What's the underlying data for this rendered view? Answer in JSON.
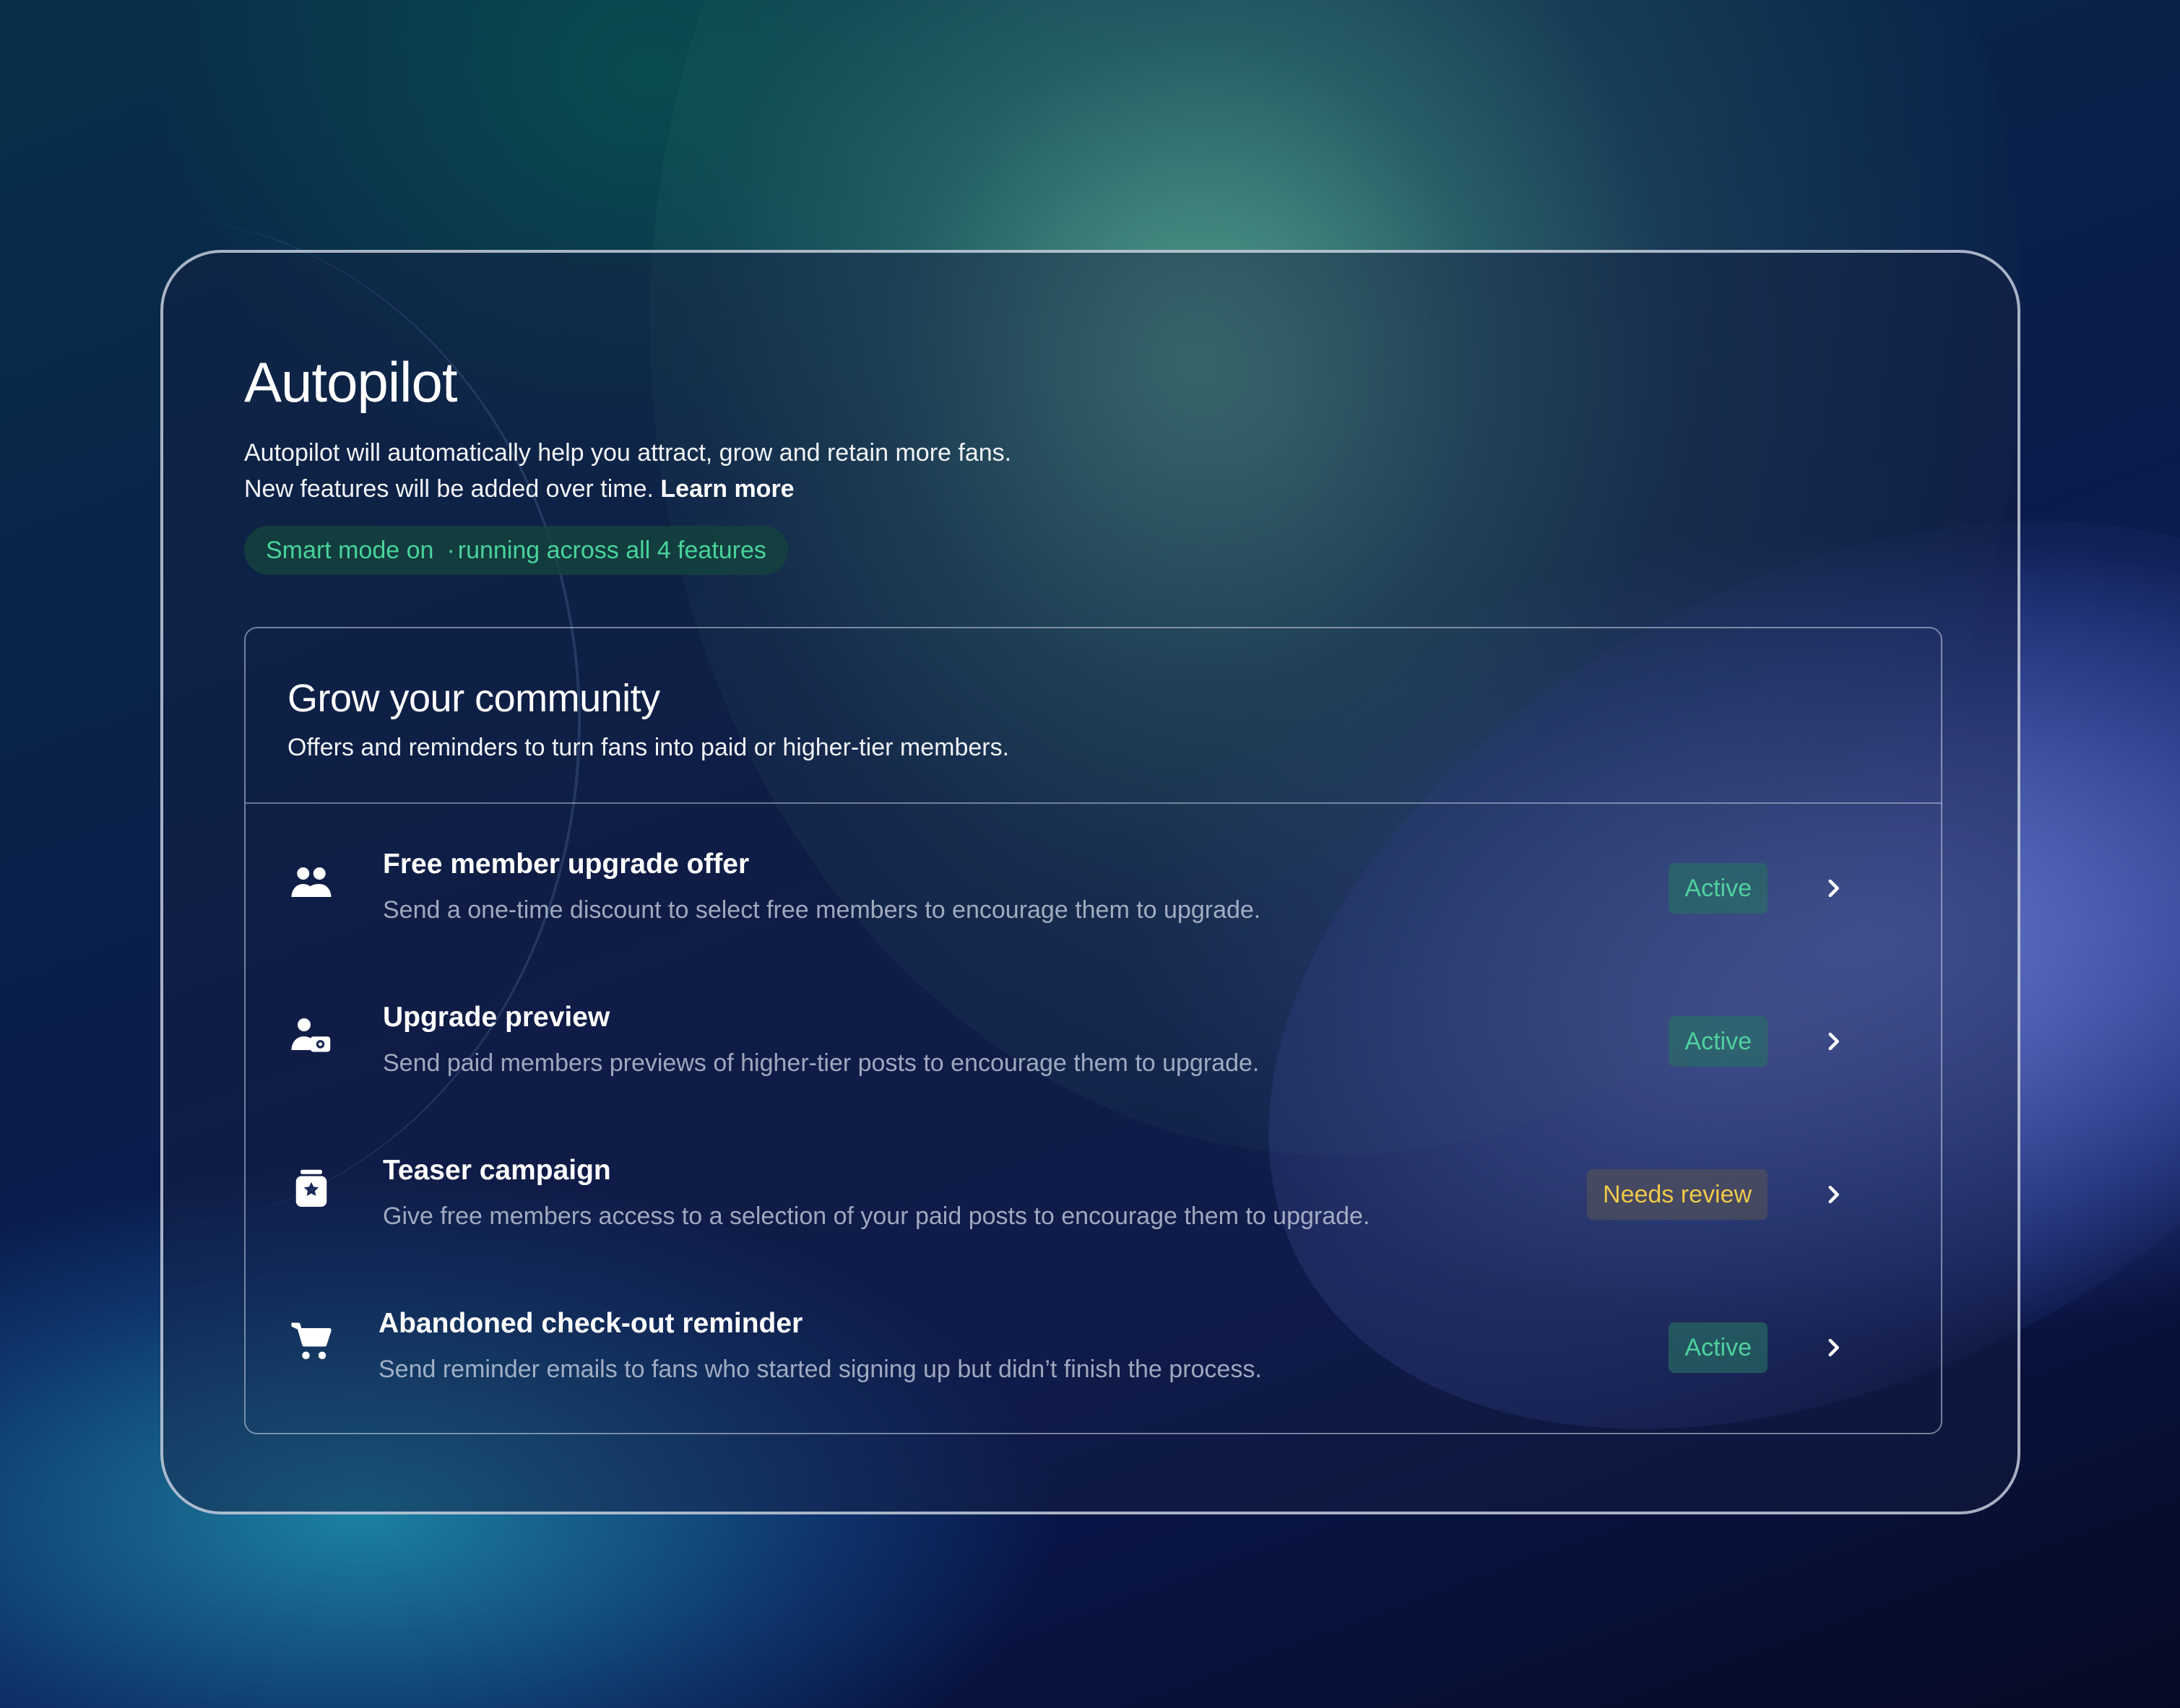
{
  "header": {
    "title": "Autopilot",
    "description": "Autopilot will automatically help you attract, grow and retain more fans. New features will be added over time.",
    "learn_more": "Learn more",
    "status_pill": {
      "mode": "Smart mode on",
      "separator": "·",
      "detail": "running across all 4 features"
    }
  },
  "section": {
    "title": "Grow your community",
    "subtitle": "Offers and reminders to turn fans into paid or higher-tier members.",
    "items": [
      {
        "icon": "users-icon",
        "name": "Free member upgrade offer",
        "description": "Send a one-time discount to select free members to encourage them to upgrade.",
        "status": "Active"
      },
      {
        "icon": "user-preview-icon",
        "name": "Upgrade preview",
        "description": "Send paid members previews of higher-tier posts to encourage them to upgrade.",
        "status": "Active"
      },
      {
        "icon": "star-box-icon",
        "name": "Teaser campaign",
        "description": "Give free members access to a selection of your paid posts to encourage them to upgrade.",
        "status": "Needs review"
      },
      {
        "icon": "cart-icon",
        "name": "Abandoned check-out reminder",
        "description": "Send reminder emails to fans who started signing up but didn’t finish the process.",
        "status": "Active"
      }
    ]
  },
  "colors": {
    "active_text": "#4fd19e",
    "review_text": "#f0c84a",
    "pill_text": "#48d39a"
  }
}
